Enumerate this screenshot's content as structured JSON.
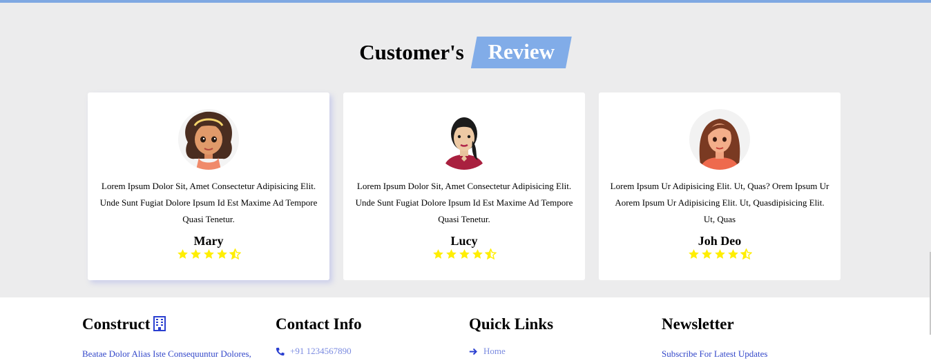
{
  "heading": {
    "plain": "Customer's",
    "highlight": "Review"
  },
  "reviews": [
    {
      "name": "Mary",
      "text": "Lorem Ipsum Dolor Sit, Amet Consectetur Adipisicing Elit. Unde Sunt Fugiat Dolore Ipsum Id Est Maxime Ad Tempore Quasi Tenetur.",
      "rating": 4.5
    },
    {
      "name": "Lucy",
      "text": "Lorem Ipsum Dolor Sit, Amet Consectetur Adipisicing Elit. Unde Sunt Fugiat Dolore Ipsum Id Est Maxime Ad Tempore Quasi Tenetur.",
      "rating": 4.5
    },
    {
      "name": "Joh Deo",
      "text": "Lorem Ipsum Ur Adipisicing Elit. Ut, Quas? Orem Ipsum Ur Aorem Ipsum Ur Adipisicing Elit. Ut, Quasdipisicing Elit. Ut, Quas",
      "rating": 4.5
    }
  ],
  "footer": {
    "construct": {
      "title": "Construct",
      "icon": "building-icon",
      "text": "Beatae Dolor Alias Iste Consequuntur Dolores,"
    },
    "contact": {
      "title": "Contact Info",
      "icon": "phone-icon",
      "phone": "+91 1234567890"
    },
    "quick_links": {
      "title": "Quick Links",
      "icon": "arrow-right-icon",
      "first_link": "Home"
    },
    "newsletter": {
      "title": "Newsletter",
      "text": "Subscribe For Latest Updates"
    }
  },
  "colors": {
    "accent": "#81ace8",
    "star": "#ffee00",
    "link": "#3347c9",
    "section_bg": "#ececed"
  }
}
